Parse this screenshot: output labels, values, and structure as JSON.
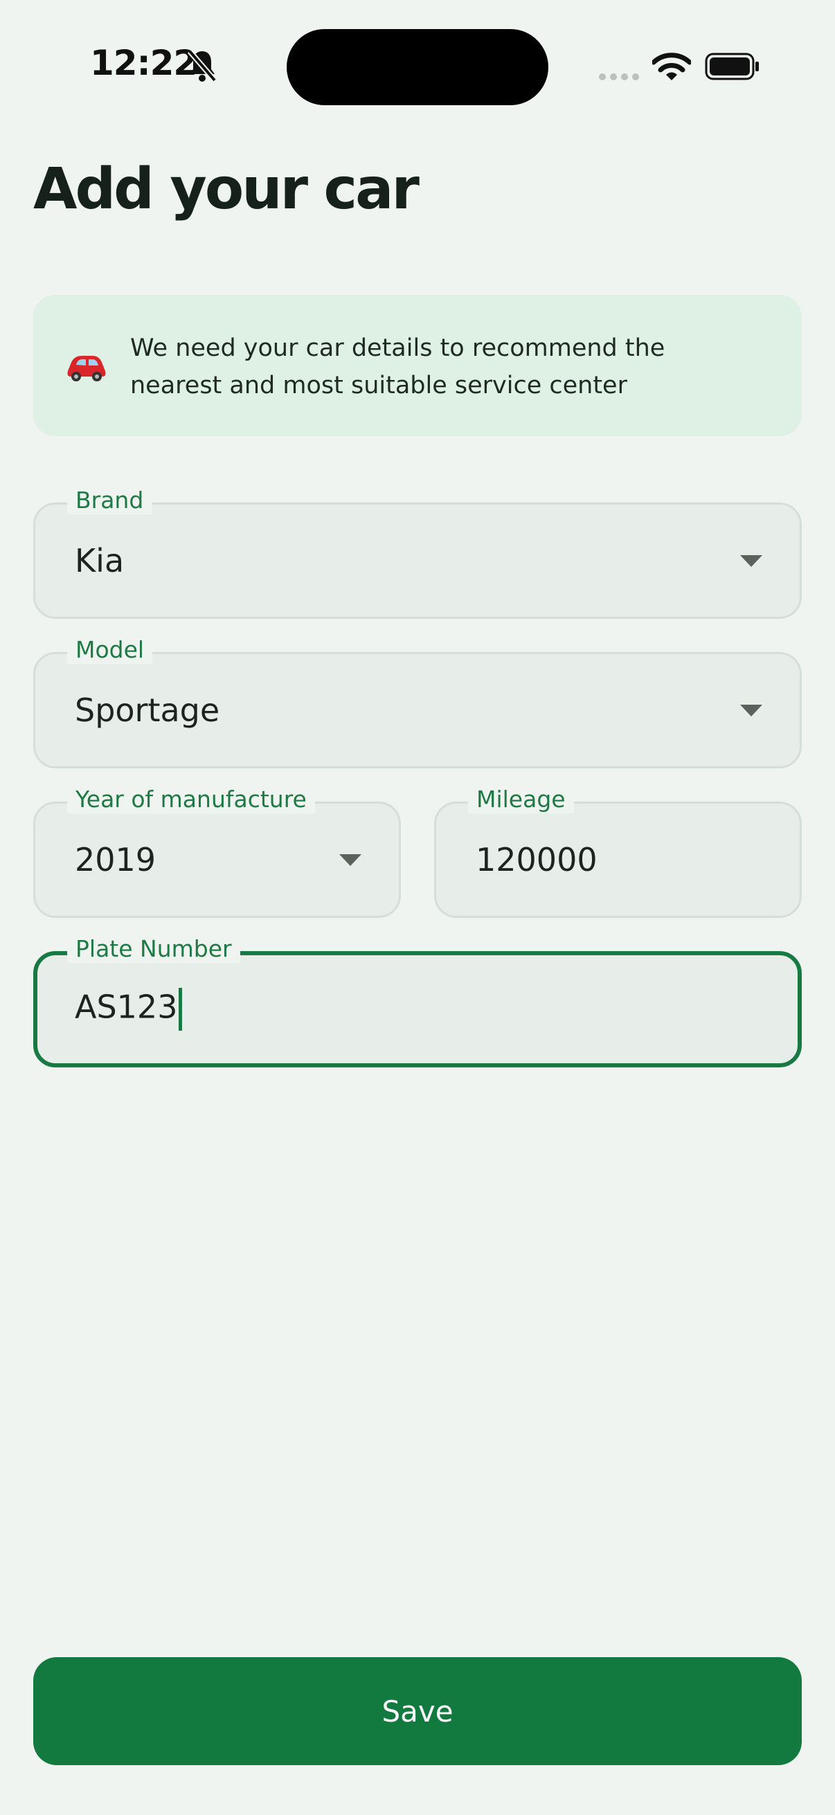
{
  "status_bar": {
    "time": "12:22"
  },
  "page": {
    "title": "Add your car"
  },
  "info_banner": {
    "text": "We need your car details to recommend the nearest and most suitable service center"
  },
  "form": {
    "brand": {
      "label": "Brand",
      "value": "Kia"
    },
    "model": {
      "label": "Model",
      "value": "Sportage"
    },
    "year": {
      "label": "Year of manufacture",
      "value": "2019"
    },
    "mileage": {
      "label": "Mileage",
      "value": "120000"
    },
    "plate": {
      "label": "Plate Number",
      "value": "AS123"
    }
  },
  "actions": {
    "save_label": "Save"
  },
  "colors": {
    "accent": "#127a3e",
    "background": "#eff4f0",
    "banner": "#dff0e4"
  }
}
